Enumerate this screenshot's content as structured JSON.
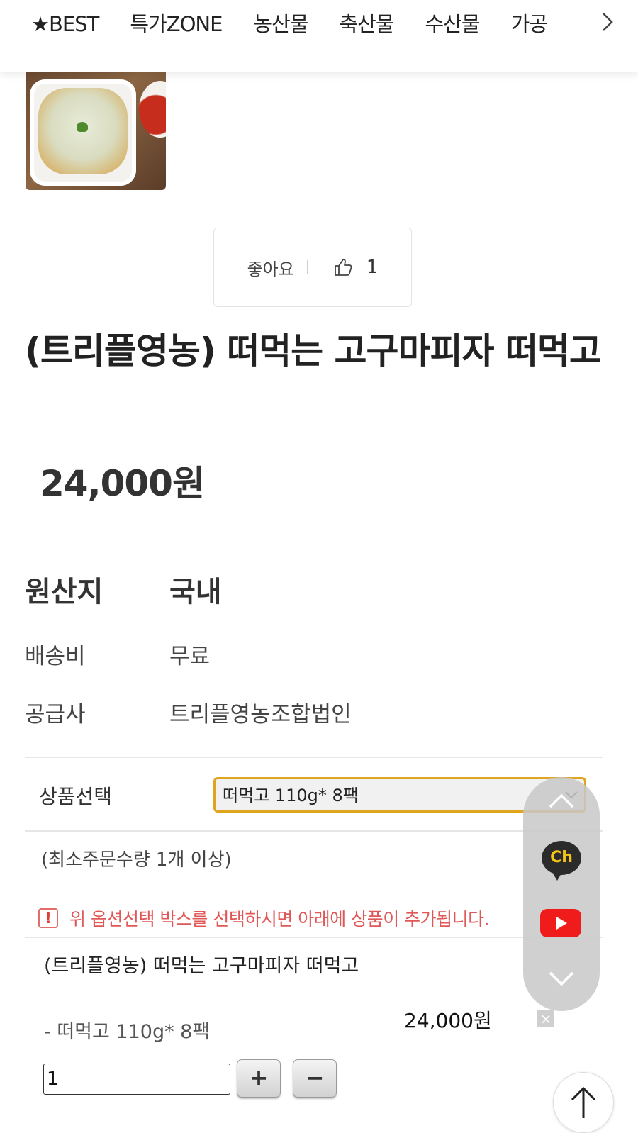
{
  "nav": {
    "tabs": [
      "★BEST",
      "특가ZONE",
      "농산물",
      "축산물",
      "수산물",
      "가공"
    ],
    "next_icon": "chevron-right-icon"
  },
  "like": {
    "label": "좋아요",
    "count": "1",
    "icon": "thumbs-up-icon"
  },
  "product": {
    "title": "(트리플영농) 떠먹는 고구마피자 떠먹고",
    "price": "24,000원"
  },
  "info": {
    "origin_label": "원산지",
    "origin_value": "국내",
    "shipping_label": "배송비",
    "shipping_value": "무료",
    "supplier_label": "공급사",
    "supplier_value": "트리플영농조합법인"
  },
  "option": {
    "label": "상품선택",
    "selected": "떠먹고 110g* 8팩",
    "min_order": "(최소주문수량 1개 이상)",
    "notice": "위 옵션선택 박스를 선택하시면 아래에 상품이 추가됩니다."
  },
  "selected_item": {
    "name": "(트리플영농) 떠먹는 고구마피자 떠먹고",
    "option": "- 떠먹고 110g* 8팩",
    "price": "24,000원",
    "quantity": "1",
    "plus": "+",
    "minus": "−",
    "delete": "×"
  },
  "side_widget": {
    "channel_label": "Ch",
    "icons": [
      "chevron-up-icon",
      "kakao-channel-icon",
      "youtube-icon",
      "chevron-down-icon"
    ]
  },
  "colors": {
    "select_border": "#e0a51e",
    "notice_text": "#e05757",
    "youtube_red": "#f01c1c"
  }
}
